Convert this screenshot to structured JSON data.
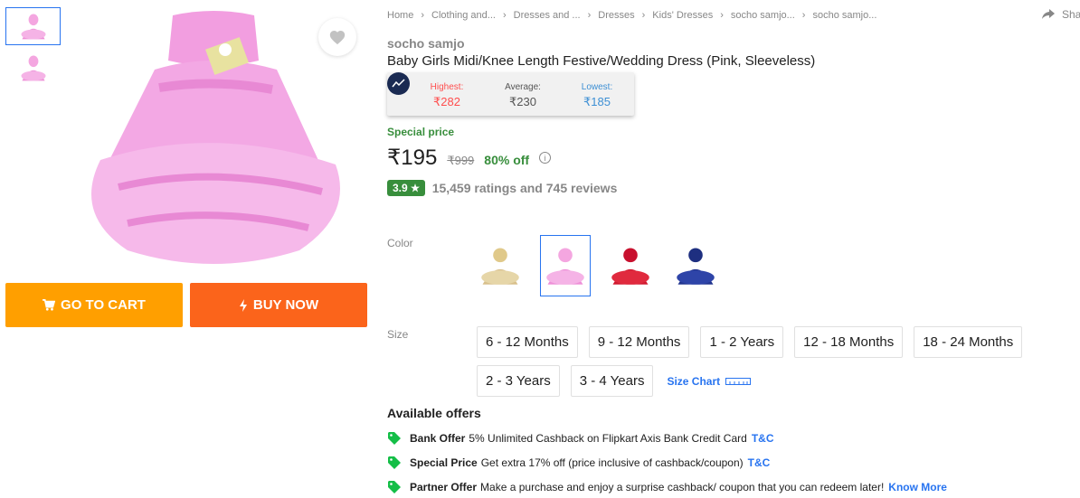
{
  "breadcrumbs": [
    "Home",
    "Clothing and...",
    "Dresses and ...",
    "Dresses",
    "Kids' Dresses",
    "socho samjo...",
    "socho samjo..."
  ],
  "share_label": "Sha",
  "product": {
    "brand": "socho samjo",
    "title": "Baby Girls Midi/Knee Length Festive/Wedding Dress  (Pink, Sleeveless)"
  },
  "price_history": {
    "highest_label": "Highest:",
    "highest_value": "₹282",
    "average_label": "Average:",
    "average_value": "₹230",
    "lowest_label": "Lowest:",
    "lowest_value": "₹185"
  },
  "pricing": {
    "special_label": "Special price",
    "price": "₹195",
    "mrp": "₹999",
    "discount": "80% off"
  },
  "rating": {
    "score": "3.9",
    "summary": "15,459 ratings and 745 reviews"
  },
  "color": {
    "label": "Color",
    "options": [
      "gold",
      "pink",
      "red",
      "blue"
    ],
    "selected": "pink"
  },
  "size": {
    "label": "Size",
    "options": [
      "6 - 12 Months",
      "9 - 12 Months",
      "1 - 2 Years",
      "12 - 18 Months",
      "18 - 24 Months",
      "2 - 3 Years",
      "3 - 4 Years"
    ],
    "chart_label": "Size Chart"
  },
  "buttons": {
    "cart": "GO TO CART",
    "buy": "BUY NOW"
  },
  "offers": {
    "title": "Available offers",
    "items": [
      {
        "type": "Bank Offer",
        "text": "5% Unlimited Cashback on Flipkart Axis Bank Credit Card",
        "link": "T&C"
      },
      {
        "type": "Special Price",
        "text": "Get extra 17% off (price inclusive of cashback/coupon)",
        "link": "T&C"
      },
      {
        "type": "Partner Offer",
        "text": "Make a purchase and enjoy a surprise cashback/ coupon that you can redeem later!",
        "link": "Know More"
      }
    ]
  },
  "colors": {
    "accent_blue": "#2874f0",
    "cart_orange": "#ff9f00",
    "buy_orange": "#fb641b",
    "green": "#388e3c",
    "highest_red": "#ff4d4d",
    "lowest_blue": "#3d8fd4"
  }
}
